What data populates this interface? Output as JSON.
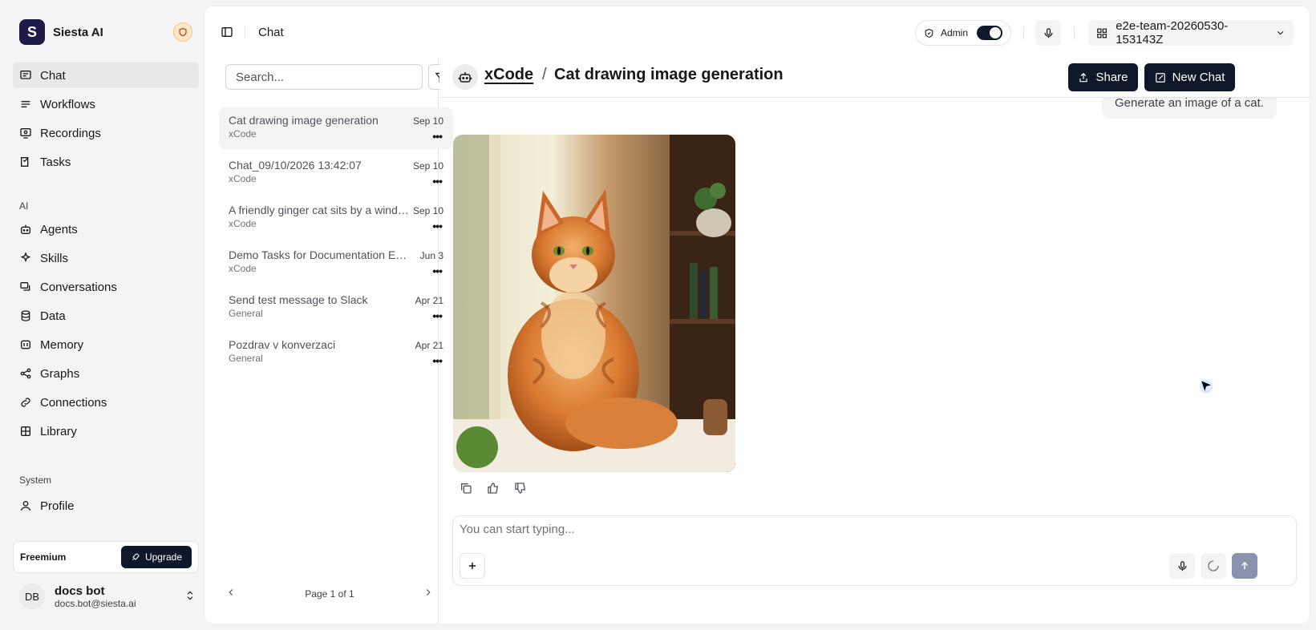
{
  "brand": {
    "name": "Siesta AI",
    "logo_letter": "S"
  },
  "nav": {
    "main": [
      {
        "label": "Chat",
        "icon": "message-square-icon",
        "active": true
      },
      {
        "label": "Workflows",
        "icon": "workflow-icon"
      },
      {
        "label": "Recordings",
        "icon": "screen-record-icon"
      },
      {
        "label": "Tasks",
        "icon": "tasks-icon"
      }
    ],
    "ai_section": "AI",
    "ai": [
      {
        "label": "Agents",
        "icon": "bot-icon"
      },
      {
        "label": "Skills",
        "icon": "sparkles-icon"
      },
      {
        "label": "Conversations",
        "icon": "messages-icon"
      },
      {
        "label": "Data",
        "icon": "database-icon"
      },
      {
        "label": "Memory",
        "icon": "brain-icon"
      },
      {
        "label": "Graphs",
        "icon": "share-graph-icon"
      },
      {
        "label": "Connections",
        "icon": "link-icon"
      },
      {
        "label": "Library",
        "icon": "grid-icon"
      }
    ],
    "system_section": "System",
    "system": [
      {
        "label": "Profile",
        "icon": "user-icon"
      }
    ]
  },
  "plan": {
    "label": "Freemium",
    "upgrade_label": "Upgrade"
  },
  "user": {
    "initials": "DB",
    "name": "docs bot",
    "email": "docs.bot@siesta.ai"
  },
  "topbar": {
    "title": "Chat",
    "admin_label": "Admin",
    "team": "e2e-team-20260530-153143Z"
  },
  "search": {
    "placeholder": "Search..."
  },
  "chats": [
    {
      "title": "Cat drawing image generation",
      "agent": "xCode",
      "date": "Sep 10",
      "active": true
    },
    {
      "title": "Chat_09/10/2026 13:42:07",
      "agent": "xCode",
      "date": "Sep 10"
    },
    {
      "title": "A friendly ginger cat sits by a window",
      "agent": "xCode",
      "date": "Sep 10"
    },
    {
      "title": "Demo Tasks for Documentation Example",
      "agent": "xCode",
      "date": "Jun 3"
    },
    {
      "title": "Send test message to Slack",
      "agent": "General",
      "date": "Apr 21"
    },
    {
      "title": "Pozdrav v konverzaci",
      "agent": "General",
      "date": "Apr 21"
    }
  ],
  "pager": {
    "label": "Page 1 of 1"
  },
  "conversation": {
    "agent": "xCode",
    "separator": "/",
    "title": "Cat drawing image generation",
    "share_label": "Share",
    "new_chat_label": "New Chat",
    "user_message": "Generate an image of a cat."
  },
  "composer": {
    "placeholder": "You can start typing..."
  },
  "colors": {
    "accent": "#0f172a",
    "send_disabled": "#8a93ad",
    "badge": "#fde8c8"
  }
}
